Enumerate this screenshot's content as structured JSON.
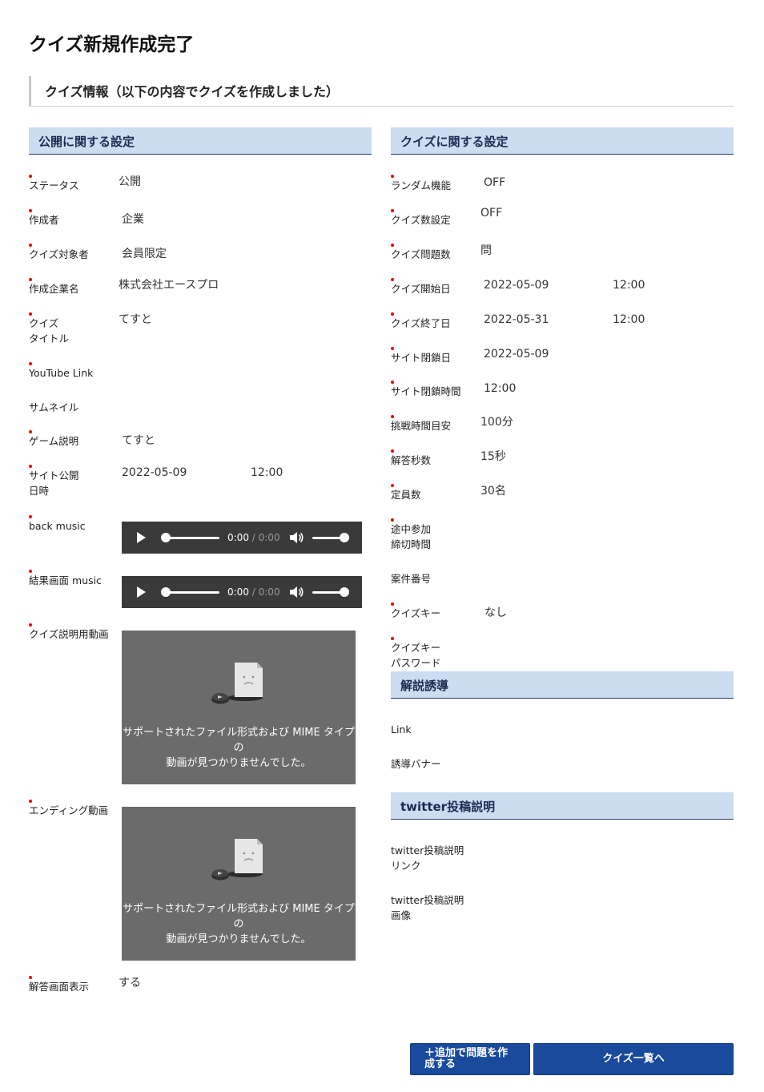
{
  "page_title": "クイズ新規作成完了",
  "info_heading": "クイズ情報（以下の内容でクイズを作成しました）",
  "left": {
    "section_title": "公開に関する設定",
    "fields": {
      "status": {
        "label": "ステータス",
        "value": "公開"
      },
      "creator": {
        "label": "作成者",
        "value": "企業"
      },
      "target": {
        "label": "クイズ対象者",
        "value": "会員限定"
      },
      "company": {
        "label": "作成企業名",
        "value": "株式会社エースプロ"
      },
      "title": {
        "label": "クイズ\nタイトル",
        "value": "てすと"
      },
      "youtube": {
        "label": "YouTube Link",
        "value": ""
      },
      "thumbnail": {
        "label": "サムネイル",
        "value": ""
      },
      "game_desc": {
        "label": "ゲーム説明",
        "value": "てすと"
      },
      "publish": {
        "label": "サイト公開\n日時",
        "date": "2022-05-09",
        "time": "12:00"
      },
      "back_music": {
        "label": "back music"
      },
      "result_music": {
        "label": "結果画面 music"
      },
      "explain_video": {
        "label": "クイズ説明用動画"
      },
      "ending_video": {
        "label": "エンディング動画"
      },
      "answer_display": {
        "label": "解答画面表示",
        "value": "する"
      }
    },
    "audio": {
      "current": "0:00",
      "separator": " / ",
      "duration": "0:00"
    },
    "video_error": "サポートされたファイル形式および MIME タイプの\n動画が見つかりませんでした。"
  },
  "right": {
    "section_title": "クイズに関する設定",
    "fields": {
      "random": {
        "label": "ランダム機能",
        "value": "OFF"
      },
      "quiz_count_setting": {
        "label": "クイズ数設定",
        "value": "OFF"
      },
      "question_count": {
        "label": "クイズ問題数",
        "value": "問"
      },
      "start": {
        "label": "クイズ開始日",
        "date": "2022-05-09",
        "time": "12:00"
      },
      "end": {
        "label": "クイズ終了日",
        "date": "2022-05-31",
        "time": "12:00"
      },
      "close_date": {
        "label": "サイト閉鎖日",
        "value": "2022-05-09"
      },
      "close_time": {
        "label": "サイト閉鎖時間",
        "value": "12:00"
      },
      "challenge_time": {
        "label": "挑戦時間目安",
        "value": "100分"
      },
      "answer_seconds": {
        "label": "解答秒数",
        "value": "15秒"
      },
      "capacity": {
        "label": "定員数",
        "value": "30名"
      },
      "midway_deadline": {
        "label": "途中参加\n締切時間",
        "value": ""
      },
      "case_number": {
        "label": "案件番号",
        "value": ""
      },
      "quiz_key": {
        "label": "クイズキー",
        "value": "なし"
      },
      "quiz_key_password": {
        "label": "クイズキー\nパスワード",
        "value": ""
      }
    },
    "guide": {
      "section_title": "解説誘導",
      "link_label": "Link",
      "banner_label": "誘導バナー"
    },
    "twitter": {
      "section_title": "twitter投稿説明",
      "link_label": "twitter投稿説明\nリンク",
      "image_label": "twitter投稿説明\n画像"
    }
  },
  "buttons": {
    "add_questions": "＋追加で問題を作\n成する",
    "quiz_list": "クイズ一覧へ"
  },
  "colors": {
    "section_bg": "#ccdcf1",
    "button_bg": "#1a4a9c",
    "required_dot": "#ee0000"
  }
}
